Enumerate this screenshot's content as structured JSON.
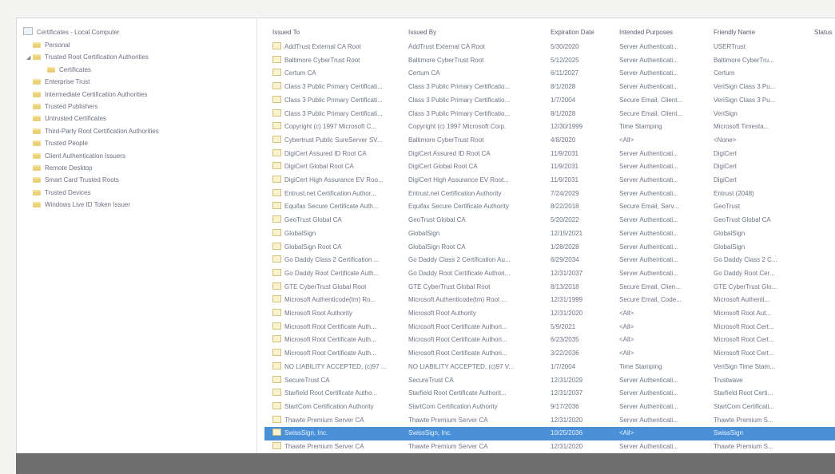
{
  "tree": {
    "root": "Certificates - Local Computer",
    "items": [
      {
        "label": "Personal",
        "level": 1,
        "expanded": false
      },
      {
        "label": "Trusted Root Certification Authorities",
        "level": 1,
        "expanded": true
      },
      {
        "label": "Certificates",
        "level": 2,
        "expanded": false
      },
      {
        "label": "Enterprise Trust",
        "level": 1,
        "expanded": false
      },
      {
        "label": "Intermediate Certification Authorities",
        "level": 1,
        "expanded": false
      },
      {
        "label": "Trusted Publishers",
        "level": 1,
        "expanded": false
      },
      {
        "label": "Untrusted Certificates",
        "level": 1,
        "expanded": false
      },
      {
        "label": "Third-Party Root Certification Authorities",
        "level": 1,
        "expanded": false
      },
      {
        "label": "Trusted People",
        "level": 1,
        "expanded": false
      },
      {
        "label": "Client Authentication Issuers",
        "level": 1,
        "expanded": false
      },
      {
        "label": "Remote Desktop",
        "level": 1,
        "expanded": false
      },
      {
        "label": "Smart Card Trusted Roots",
        "level": 1,
        "expanded": false
      },
      {
        "label": "Trusted Devices",
        "level": 1,
        "expanded": false
      },
      {
        "label": "Windows Live ID Token Issuer",
        "level": 1,
        "expanded": false
      }
    ]
  },
  "list": {
    "columns": [
      "Issued To",
      "Issued By",
      "Expiration Date",
      "Intended Purposes",
      "Friendly Name",
      "Status"
    ],
    "selected_index": 29,
    "rows": [
      [
        "AddTrust External CA Root",
        "AddTrust External CA Root",
        "5/30/2020",
        "Server Authenticati...",
        "USERTrust"
      ],
      [
        "Baltimore CyberTrust Root",
        "Baltimore CyberTrust Root",
        "5/12/2025",
        "Server Authenticati...",
        "Baltimore CyberTru..."
      ],
      [
        "Certum CA",
        "Certum CA",
        "6/11/2027",
        "Server Authenticati...",
        "Certum"
      ],
      [
        "Class 3 Public Primary Certificati...",
        "Class 3 Public Primary Certificatio...",
        "8/1/2028",
        "Server Authenticati...",
        "VeriSign Class 3 Pu..."
      ],
      [
        "Class 3 Public Primary Certificati...",
        "Class 3 Public Primary Certificatio...",
        "1/7/2004",
        "Secure Email, Client...",
        "VeriSign Class 3 Pu..."
      ],
      [
        "Class 3 Public Primary Certificati...",
        "Class 3 Public Primary Certificatio...",
        "8/1/2028",
        "Secure Email, Client...",
        "VeriSign"
      ],
      [
        "Copyright (c) 1997 Microsoft C...",
        "Copyright (c) 1997 Microsoft Corp.",
        "12/30/1999",
        "Time Stamping",
        "Microsoft Timesta..."
      ],
      [
        "Cybertrust Public SureServer SV...",
        "Baltimore CyberTrust Root",
        "4/8/2020",
        "<All>",
        "<None>"
      ],
      [
        "DigiCert Assured ID Root CA",
        "DigiCert Assured ID Root CA",
        "11/9/2031",
        "Server Authenticati...",
        "DigiCert"
      ],
      [
        "DigiCert Global Root CA",
        "DigiCert Global Root CA",
        "11/9/2031",
        "Server Authenticati...",
        "DigiCert"
      ],
      [
        "DigiCert High Assurance EV Roo...",
        "DigiCert High Assurance EV Root...",
        "11/9/2031",
        "Server Authenticati...",
        "DigiCert"
      ],
      [
        "Entrust.net Certification Author...",
        "Entrust.net Certification Authority",
        "7/24/2029",
        "Server Authenticati...",
        "Entrust (2048)"
      ],
      [
        "Equifax Secure Certificate Auth...",
        "Equifax Secure Certificate Authority",
        "8/22/2018",
        "Secure Email, Serv...",
        "GeoTrust"
      ],
      [
        "GeoTrust Global CA",
        "GeoTrust Global CA",
        "5/20/2022",
        "Server Authenticati...",
        "GeoTrust Global CA"
      ],
      [
        "GlobalSign",
        "GlobalSign",
        "12/15/2021",
        "Server Authenticati...",
        "GlobalSign"
      ],
      [
        "GlobalSign Root CA",
        "GlobalSign Root CA",
        "1/28/2028",
        "Server Authenticati...",
        "GlobalSign"
      ],
      [
        "Go Daddy Class 2 Certification ...",
        "Go Daddy Class 2 Certification Au...",
        "6/29/2034",
        "Server Authenticati...",
        "Go Daddy Class 2 C..."
      ],
      [
        "Go Daddy Root Certificate Auth...",
        "Go Daddy Root Certificate Authori...",
        "12/31/2037",
        "Server Authenticati...",
        "Go Daddy Root Cer..."
      ],
      [
        "GTE CyberTrust Global Root",
        "GTE CyberTrust Global Root",
        "8/13/2018",
        "Secure Email, Clien...",
        "GTE CyberTrust Glo..."
      ],
      [
        "Microsoft Authenticode(tm) Ro...",
        "Microsoft Authenticode(tm) Root ...",
        "12/31/1999",
        "Secure Email, Code...",
        "Microsoft Authenti..."
      ],
      [
        "Microsoft Root Authority",
        "Microsoft Root Authority",
        "12/31/2020",
        "<All>",
        "Microsoft Root Aut..."
      ],
      [
        "Microsoft Root Certificate Auth...",
        "Microsoft Root Certificate Authori...",
        "5/9/2021",
        "<All>",
        "Microsoft Root Cert..."
      ],
      [
        "Microsoft Root Certificate Auth...",
        "Microsoft Root Certificate Authori...",
        "6/23/2035",
        "<All>",
        "Microsoft Root Cert..."
      ],
      [
        "Microsoft Root Certificate Auth...",
        "Microsoft Root Certificate Authori...",
        "3/22/2036",
        "<All>",
        "Microsoft Root Cert..."
      ],
      [
        "NO LIABILITY ACCEPTED, (c)97 ...",
        "NO LIABILITY ACCEPTED, (c)97 V...",
        "1/7/2004",
        "Time Stamping",
        "VeriSign Time Stam..."
      ],
      [
        "SecureTrust CA",
        "SecureTrust CA",
        "12/31/2029",
        "Server Authenticati...",
        "Trustwave"
      ],
      [
        "Starfield Root Certificate Autho...",
        "Starfield Root Certificate Authorit...",
        "12/31/2037",
        "Server Authenticati...",
        "Starfield Root Certi..."
      ],
      [
        "StartCom Certification Authority",
        "StartCom Certification Authority",
        "9/17/2036",
        "Server Authenticati...",
        "StartCom Certificati..."
      ],
      [
        "Thawte Premium Server CA",
        "Thawte Premium Server CA",
        "12/31/2020",
        "Server Authenticati...",
        "Thawte Premium S..."
      ],
      [
        "SwissSign, Inc.",
        "SwissSign, Inc.",
        "10/25/2036",
        "<All>",
        "SwissSign"
      ],
      [
        "Thawte Premium Server CA",
        "Thawte Premium Server CA",
        "12/31/2020",
        "Server Authenticati...",
        "Thawte Premium S..."
      ]
    ]
  },
  "colors": {
    "selection": "#4a90d9",
    "folder": "#e9d27a",
    "bottom_bar": "#6e6e6e"
  }
}
